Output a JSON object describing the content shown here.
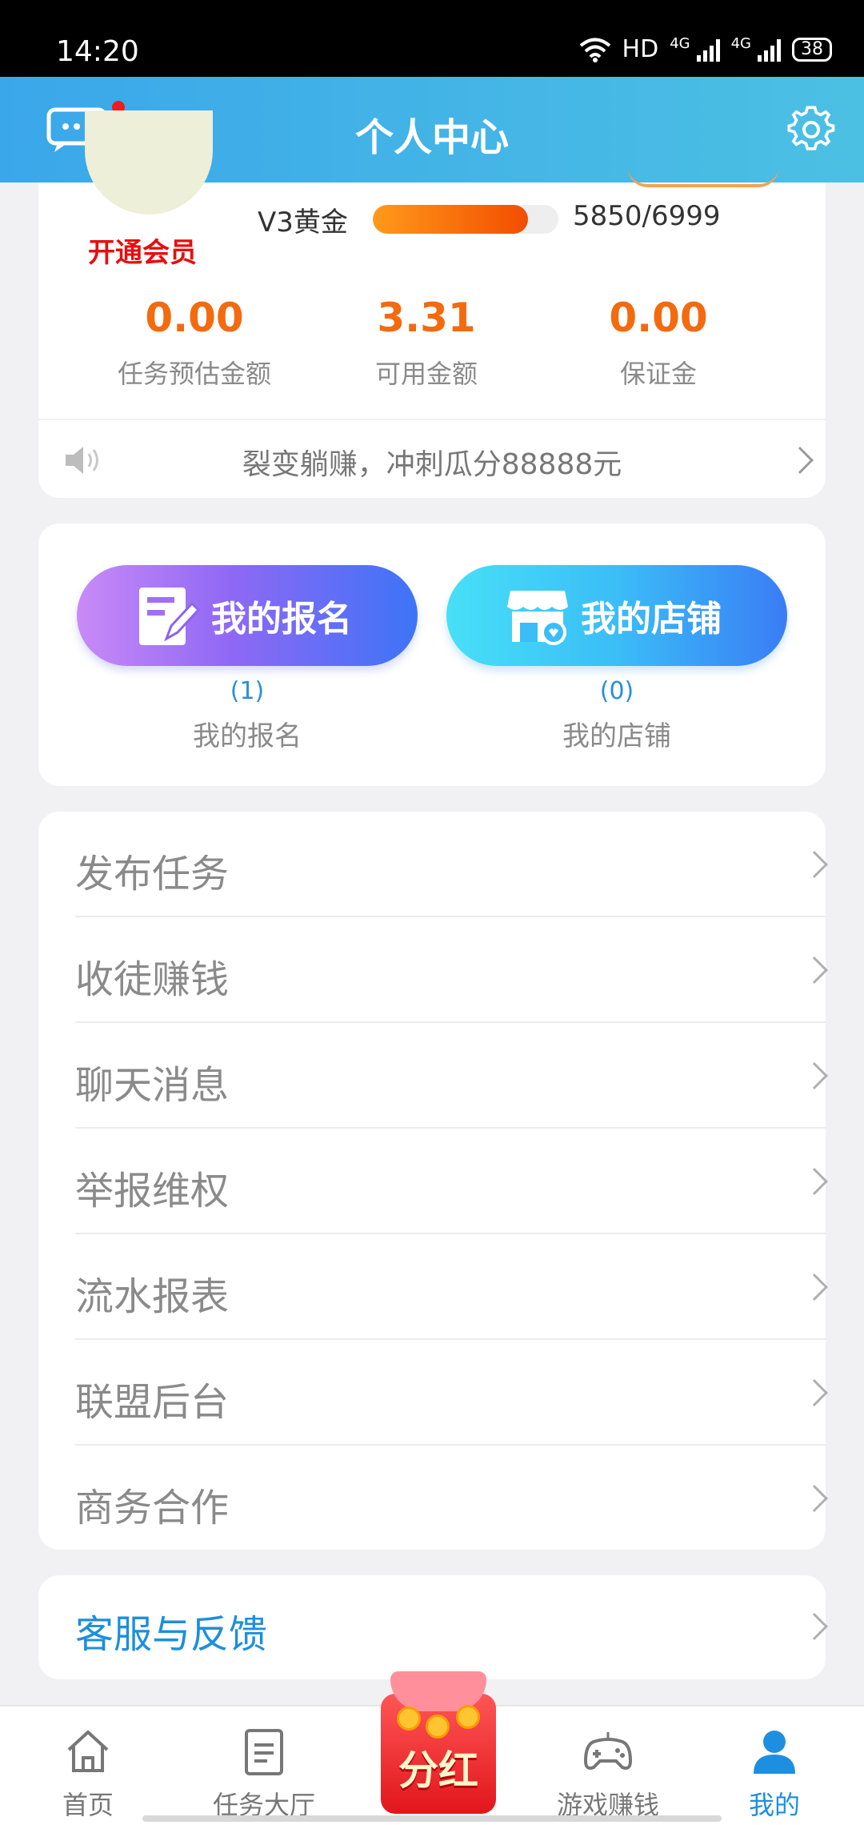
{
  "status_bar": {
    "time": "14:20",
    "network": "HD",
    "signal1": "4G",
    "signal2": "4G",
    "battery": "38"
  },
  "header": {
    "title": "个人中心"
  },
  "profile": {
    "open_vip": "开通会员",
    "level": "V3黄金",
    "exp_text": "5850/6999",
    "progress_fraction": 0.836,
    "stats": [
      {
        "value": "0.00",
        "label": "任务预估金额"
      },
      {
        "value": "3.31",
        "label": "可用金额"
      },
      {
        "value": "0.00",
        "label": "保证金"
      }
    ],
    "notice": "裂变躺赚，冲刺瓜分88888元"
  },
  "quick": {
    "registration": {
      "button": "我的报名",
      "count": "(1)",
      "label": "我的报名"
    },
    "shop": {
      "button": "我的店铺",
      "count": "(0)",
      "label": "我的店铺"
    }
  },
  "menu": [
    "发布任务",
    "收徒赚钱",
    "聊天消息",
    "举报维权",
    "流水报表",
    "联盟后台",
    "商务合作"
  ],
  "support": {
    "label": "客服与反馈"
  },
  "tabs": [
    {
      "label": "首页",
      "icon": "home-icon"
    },
    {
      "label": "任务大厅",
      "icon": "document-icon"
    },
    {
      "label": "分红",
      "icon": "red-envelope-icon"
    },
    {
      "label": "游戏赚钱",
      "icon": "gamepad-icon"
    },
    {
      "label": "我的",
      "icon": "user-icon"
    }
  ],
  "colors": {
    "accent": "#1e8fe0",
    "header": "#3aa7ea",
    "value": "#f36a0f",
    "vip": "#e50f0f"
  }
}
